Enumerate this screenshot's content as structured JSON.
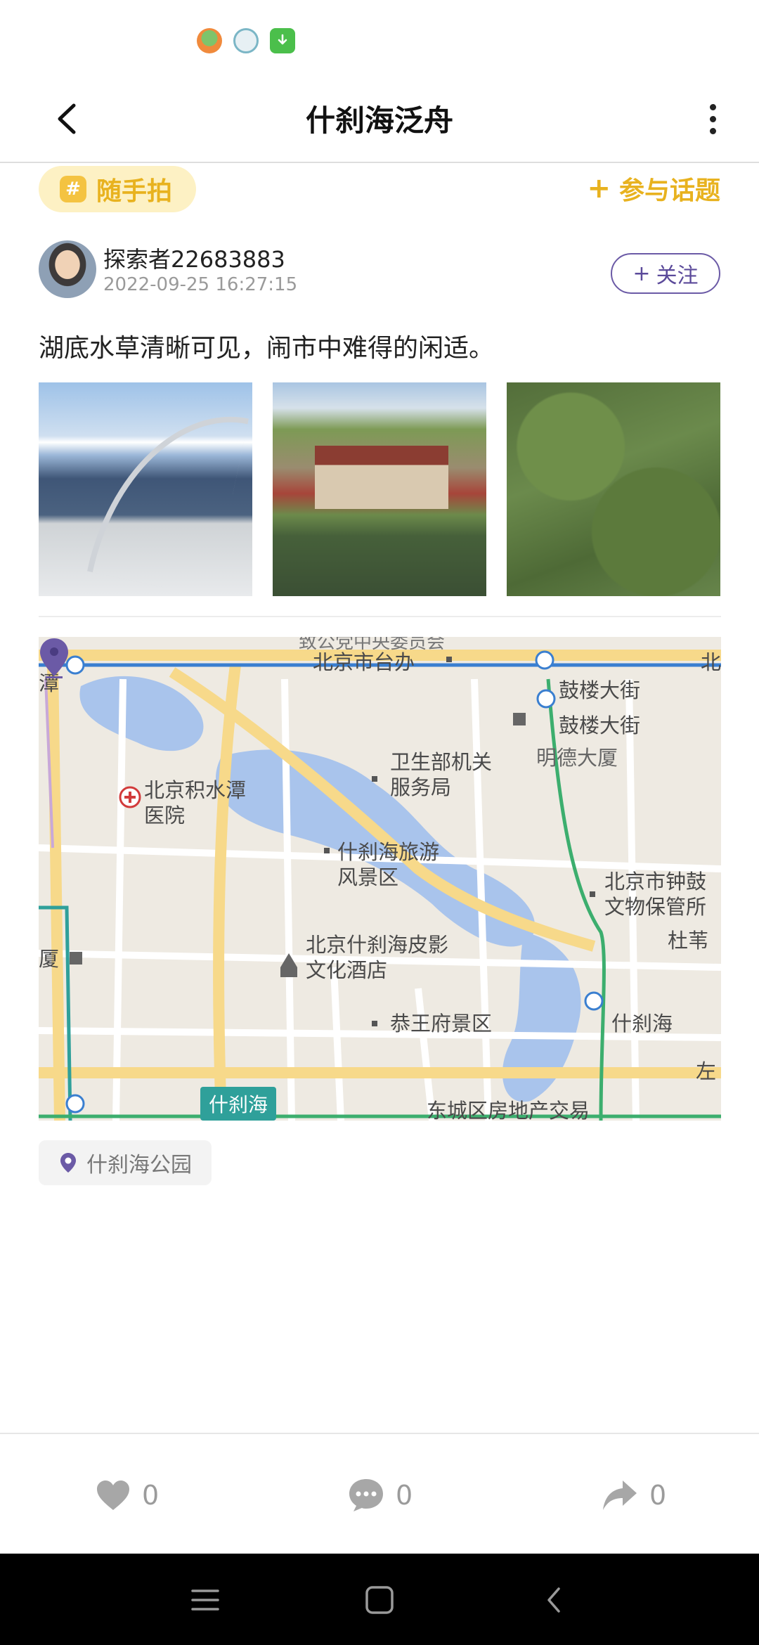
{
  "status_bar": {
    "icons": [
      "app-mascot-icon",
      "cloud-icon",
      "download-icon"
    ]
  },
  "header": {
    "title": "什刹海泛舟",
    "back_icon": "chevron-left-icon",
    "more_icon": "more-vertical-icon"
  },
  "topic": {
    "badge": "#",
    "label": "随手拍",
    "join_label": "参与话题",
    "join_prefix": "+"
  },
  "post": {
    "author": "探索者22683883",
    "time": "2022-09-25 16:27:15",
    "follow_label": "关注",
    "follow_prefix": "+",
    "text": "湖底水草清晰可见，闹市中难得的闲适。",
    "photos": [
      "lake-boat-photo",
      "pavilion-willow-photo",
      "water-grass-photo"
    ]
  },
  "map": {
    "labels": {
      "l1": "北京市台办",
      "l2": "鼓楼大街",
      "l3": "鼓楼大街",
      "l4": "明德大厦",
      "l5": "卫生部机关\n服务局",
      "l6": "北京积水潭\n医院",
      "l7": "什刹海旅游\n风景区",
      "l8": "北京市钟鼓\n文物保管所",
      "l9": "北京什刹海皮影\n文化酒店",
      "l10": "恭王府景区",
      "l11": "什刹海",
      "l12": "杜苇",
      "l13": "东城区房地产交易",
      "l14": "潭",
      "l15": "厦",
      "l16": "北",
      "l17": "左",
      "l18": "致公党中央委员会"
    },
    "station_badge": "什刹海",
    "colors": {
      "water": "#a9c4ec",
      "road_major": "#f7d98a",
      "subway_green": "#3cae6e",
      "subway_blue": "#3a7fd0",
      "pin": "#6b5aa6"
    }
  },
  "location": {
    "icon": "location-pin-icon",
    "label": "什刹海公园"
  },
  "actions": {
    "likes": "0",
    "comments": "0",
    "shares": "0"
  },
  "nav": {
    "menu_icon": "menu-icon",
    "home_icon": "home-icon",
    "back_icon": "back-icon"
  },
  "colors": {
    "accent_yellow": "#e8b21f",
    "accent_purple": "#6b5aa6"
  }
}
